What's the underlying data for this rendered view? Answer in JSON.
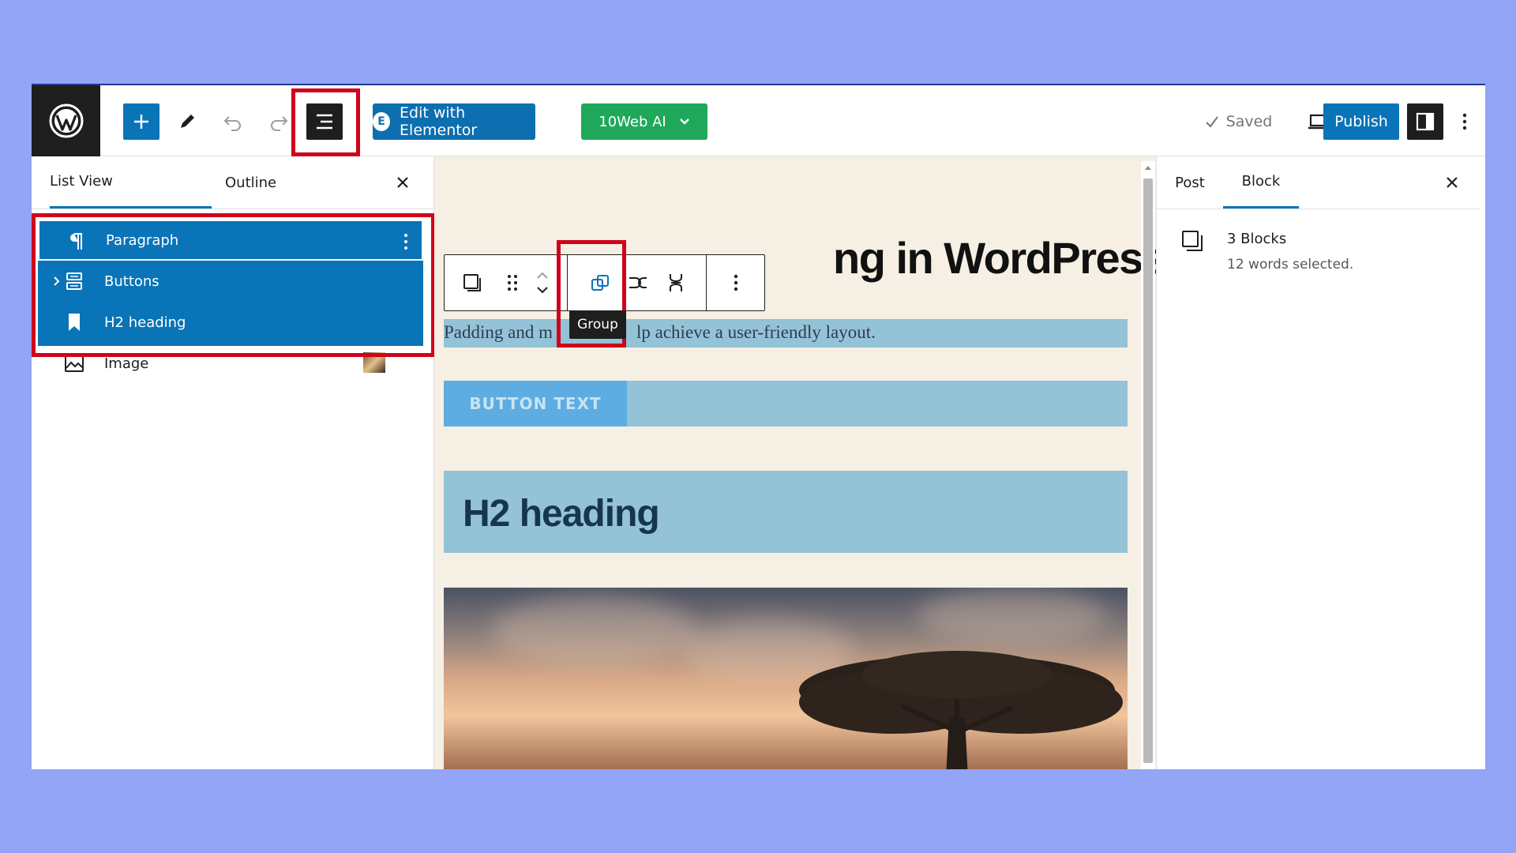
{
  "topbar": {
    "elementor_label": "Edit with Elementor",
    "elementor_badge": "E",
    "tenweb_label": "10Web AI",
    "saved_label": "Saved",
    "publish_label": "Publish"
  },
  "left_panel": {
    "tabs": [
      "List View",
      "Outline"
    ],
    "items": [
      {
        "label": "Paragraph"
      },
      {
        "label": "Buttons"
      },
      {
        "label": "H2 heading"
      },
      {
        "label": "Image"
      }
    ]
  },
  "canvas": {
    "heading_fragment": "ng in WordPress?",
    "tooltip": "Group",
    "paragraph": {
      "start": "Padding and m",
      "end": "lp achieve a user-friendly layout."
    },
    "button_text": "BUTTON TEXT",
    "h2_text": "H2 heading"
  },
  "right_panel": {
    "tabs": [
      "Post",
      "Block"
    ],
    "blocks_count": "3 Blocks",
    "blocks_desc": "12 words selected."
  },
  "colors": {
    "accent": "#0a74b8",
    "highlight": "#d0021b",
    "selected_block": "#94c2d6"
  }
}
